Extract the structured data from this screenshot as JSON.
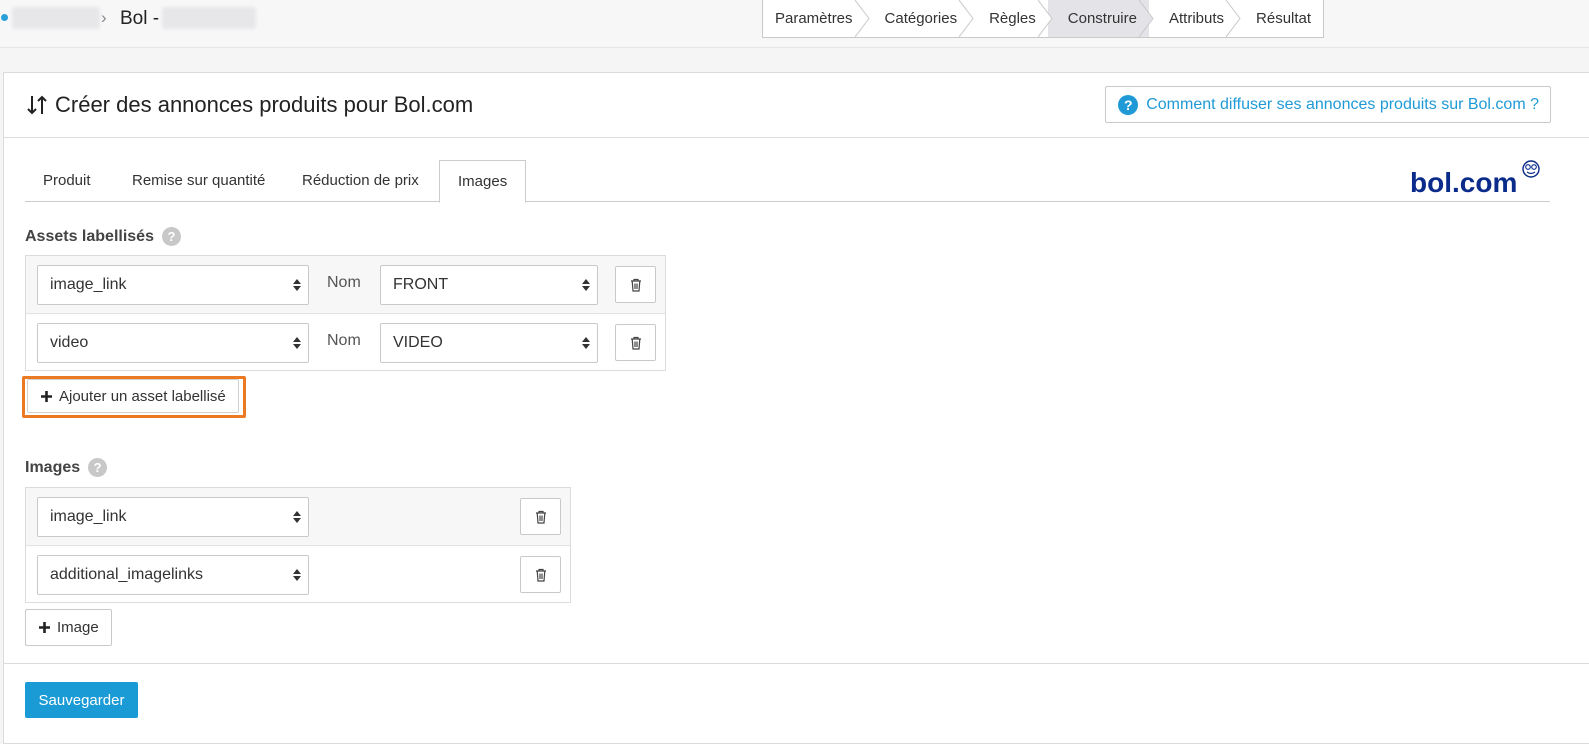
{
  "breadcrumb": {
    "separator": "›",
    "title": "Bol -"
  },
  "steps": [
    {
      "label": "Paramètres"
    },
    {
      "label": "Catégories"
    },
    {
      "label": "Règles"
    },
    {
      "label": "Construire",
      "active": true
    },
    {
      "label": "Attributs"
    },
    {
      "label": "Résultat"
    }
  ],
  "header": {
    "title": "Créer des annonces produits pour Bol.com",
    "help_label": "Comment diffuser ses annonces produits sur Bol.com ?"
  },
  "tabs": [
    {
      "label": "Produit"
    },
    {
      "label": "Remise sur quantité"
    },
    {
      "label": "Réduction de prix"
    },
    {
      "label": "Images",
      "active": true
    }
  ],
  "logo_text": "bol.com",
  "labelled_assets": {
    "title": "Assets labellisés",
    "rows": [
      {
        "field": "image_link",
        "name_label": "Nom",
        "name_value": "FRONT"
      },
      {
        "field": "video",
        "name_label": "Nom",
        "name_value": "VIDEO"
      }
    ],
    "add_label": "Ajouter un asset labellisé"
  },
  "images": {
    "title": "Images",
    "rows": [
      {
        "field": "image_link"
      },
      {
        "field": "additional_imagelinks"
      }
    ],
    "add_label": "Image"
  },
  "save_label": "Sauvegarder",
  "colors": {
    "accent": "#1a9bd6",
    "highlight": "#ec7a22"
  }
}
